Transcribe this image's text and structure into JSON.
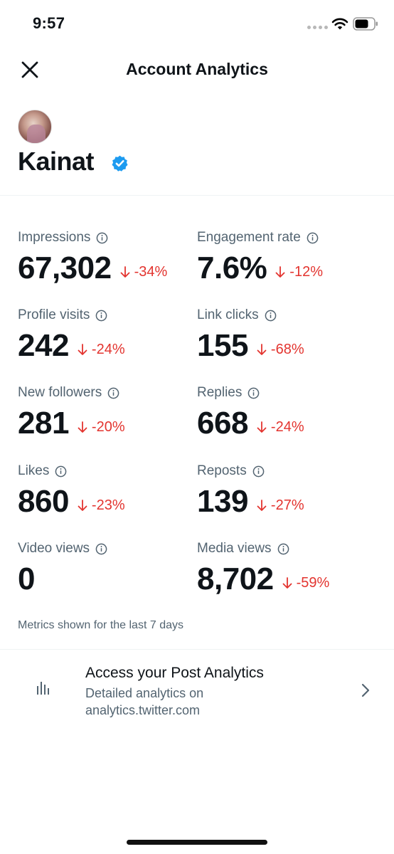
{
  "status_bar": {
    "time": "9:57"
  },
  "header": {
    "title": "Account Analytics"
  },
  "profile": {
    "name": "Kainat"
  },
  "metrics": [
    {
      "label": "Impressions",
      "value": "67,302",
      "change": "-34%"
    },
    {
      "label": "Engagement rate",
      "value": "7.6%",
      "change": "-12%"
    },
    {
      "label": "Profile visits",
      "value": "242",
      "change": "-24%"
    },
    {
      "label": "Link clicks",
      "value": "155",
      "change": "-68%"
    },
    {
      "label": "New followers",
      "value": "281",
      "change": "-20%"
    },
    {
      "label": "Replies",
      "value": "668",
      "change": "-24%"
    },
    {
      "label": "Likes",
      "value": "860",
      "change": "-23%"
    },
    {
      "label": "Reposts",
      "value": "139",
      "change": "-27%"
    },
    {
      "label": "Video views",
      "value": "0",
      "change": ""
    },
    {
      "label": "Media views",
      "value": "8,702",
      "change": "-59%"
    }
  ],
  "footnote": "Metrics shown for the last 7 days",
  "post_analytics": {
    "title": "Access your Post Analytics",
    "subtitle_line1": "Detailed analytics on",
    "subtitle_line2": "analytics.twitter.com"
  },
  "colors": {
    "negative_change": "#e3342f",
    "verified": "#1d9bf0",
    "secondary_text": "#536471"
  },
  "icons": {
    "close": "close-icon",
    "verified": "verified-badge-icon",
    "info": "info-icon",
    "down_arrow": "arrow-down-icon",
    "analytics": "bar-chart-icon",
    "chevron": "chevron-right-icon"
  }
}
